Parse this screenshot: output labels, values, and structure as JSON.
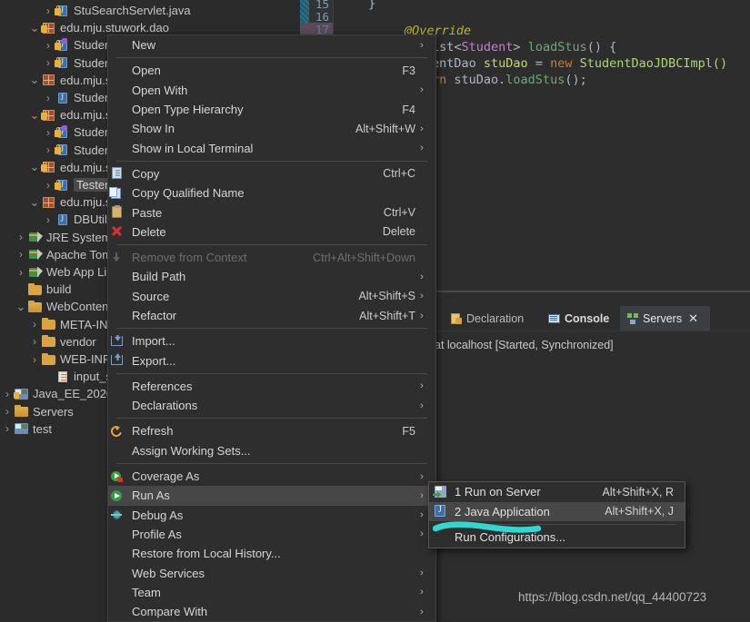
{
  "editor": {
    "line_numbers": [
      "15",
      "16",
      "17"
    ],
    "lines": [
      {
        "segments": [
          {
            "t": "}",
            "c": "c-plain"
          }
        ]
      },
      {
        "segments": []
      },
      {
        "segments": [
          {
            "t": "@Override",
            "c": "c-ann"
          }
        ]
      },
      {
        "segments": [
          {
            "t": "ist<",
            "c": "c-plain"
          },
          {
            "t": "Student",
            "c": "c-type"
          },
          {
            "t": "> ",
            "c": "c-plain"
          },
          {
            "t": "loadStus",
            "c": "c-meth"
          },
          {
            "t": "() {",
            "c": "c-plain"
          }
        ]
      },
      {
        "segments": [
          {
            "t": "entDao ",
            "c": "c-plain"
          },
          {
            "t": "stuDao",
            "c": "c-ident"
          },
          {
            "t": " = ",
            "c": "c-plain"
          },
          {
            "t": "new ",
            "c": "c-kw"
          },
          {
            "t": "StudentDaoJDBCImpl()",
            "c": "c-cls"
          }
        ]
      },
      {
        "segments": [
          {
            "t": "rn ",
            "c": "c-kw"
          },
          {
            "t": "stuDao.",
            "c": "c-plain"
          },
          {
            "t": "loadStus",
            "c": "c-meth"
          },
          {
            "t": "();",
            "c": "c-plain"
          }
        ]
      }
    ]
  },
  "panel": {
    "tabs": [
      {
        "label": "Declaration",
        "icon": "declaration-icon",
        "active": false,
        "bold": false,
        "closable": false
      },
      {
        "label": "Console",
        "icon": "console-icon",
        "active": false,
        "bold": true,
        "closable": false
      },
      {
        "label": "Servers",
        "icon": "servers-icon",
        "active": true,
        "bold": false,
        "closable": true
      }
    ],
    "close_glyph": "✕",
    "server_row": "at localhost  [Started, Synchronized]"
  },
  "tree": {
    "items": [
      {
        "label": "StuSearchServlet.java",
        "indent": 3,
        "twisty": "collapsed",
        "icon": "java-file-locked",
        "selected": false
      },
      {
        "label": "edu.mju.stuwork.dao",
        "indent": 2,
        "twisty": "expanded",
        "icon": "package-locked",
        "selected": false
      },
      {
        "label": "Studen",
        "indent": 3,
        "twisty": "collapsed",
        "icon": "java-interface-locked",
        "selected": false
      },
      {
        "label": "Studen",
        "indent": 3,
        "twisty": "collapsed",
        "icon": "java-file-locked",
        "selected": false
      },
      {
        "label": "edu.mju.s",
        "indent": 2,
        "twisty": "expanded",
        "icon": "package",
        "selected": false
      },
      {
        "label": "Studen",
        "indent": 3,
        "twisty": "collapsed",
        "icon": "java-file",
        "selected": false
      },
      {
        "label": "edu.mju.s",
        "indent": 2,
        "twisty": "expanded",
        "icon": "package-locked",
        "selected": false
      },
      {
        "label": "Studen",
        "indent": 3,
        "twisty": "collapsed",
        "icon": "java-interface-locked",
        "selected": false
      },
      {
        "label": "Studen",
        "indent": 3,
        "twisty": "collapsed",
        "icon": "java-file-locked",
        "selected": false
      },
      {
        "label": "edu.mju.s",
        "indent": 2,
        "twisty": "expanded",
        "icon": "package-locked",
        "selected": false
      },
      {
        "label": "Tester.",
        "indent": 3,
        "twisty": "collapsed",
        "icon": "java-file-locked",
        "selected": true
      },
      {
        "label": "edu.mju.s",
        "indent": 2,
        "twisty": "expanded",
        "icon": "package",
        "selected": false
      },
      {
        "label": "DBUtils",
        "indent": 3,
        "twisty": "collapsed",
        "icon": "java-file",
        "selected": false
      },
      {
        "label": "JRE System ",
        "indent": 1,
        "twisty": "collapsed",
        "icon": "library",
        "selected": false
      },
      {
        "label": "Apache Tom",
        "indent": 1,
        "twisty": "collapsed",
        "icon": "library",
        "selected": false
      },
      {
        "label": "Web App Lil",
        "indent": 1,
        "twisty": "collapsed",
        "icon": "library",
        "selected": false
      },
      {
        "label": "build",
        "indent": 1,
        "twisty": "none",
        "icon": "folder",
        "selected": false
      },
      {
        "label": "WebContent",
        "indent": 1,
        "twisty": "expanded",
        "icon": "folder-open",
        "selected": false
      },
      {
        "label": "META-INI",
        "indent": 2,
        "twisty": "collapsed",
        "icon": "folder",
        "selected": false
      },
      {
        "label": "vendor",
        "indent": 2,
        "twisty": "collapsed",
        "icon": "folder",
        "selected": false
      },
      {
        "label": "WEB-INF",
        "indent": 2,
        "twisty": "collapsed",
        "icon": "folder",
        "selected": false
      },
      {
        "label": "input_stud",
        "indent": 3,
        "twisty": "none",
        "icon": "html-file",
        "selected": false
      },
      {
        "label": "Java_EE_2020-1",
        "indent": 0,
        "twisty": "collapsed",
        "icon": "project-locked",
        "selected": false
      },
      {
        "label": "Servers",
        "indent": 0,
        "twisty": "collapsed",
        "icon": "folder-project",
        "selected": false
      },
      {
        "label": "test",
        "indent": 0,
        "twisty": "collapsed",
        "icon": "project",
        "selected": false
      }
    ]
  },
  "context_menu": {
    "arrow_glyph": "›",
    "items": [
      {
        "label": "New",
        "accel": "",
        "icon": "",
        "arrow": true,
        "sep_after": true,
        "disabled": false,
        "highlight": false
      },
      {
        "label": "Open",
        "accel": "F3",
        "icon": "",
        "arrow": false,
        "sep_after": false,
        "disabled": false,
        "highlight": false
      },
      {
        "label": "Open With",
        "accel": "",
        "icon": "",
        "arrow": true,
        "sep_after": false,
        "disabled": false,
        "highlight": false
      },
      {
        "label": "Open Type Hierarchy",
        "accel": "F4",
        "icon": "",
        "arrow": false,
        "sep_after": false,
        "disabled": false,
        "highlight": false
      },
      {
        "label": "Show In",
        "accel": "Alt+Shift+W",
        "icon": "",
        "arrow": true,
        "sep_after": false,
        "disabled": false,
        "highlight": false
      },
      {
        "label": "Show in Local Terminal",
        "accel": "",
        "icon": "",
        "arrow": true,
        "sep_after": true,
        "disabled": false,
        "highlight": false
      },
      {
        "label": "Copy",
        "accel": "Ctrl+C",
        "icon": "copy-icon",
        "arrow": false,
        "sep_after": false,
        "disabled": false,
        "highlight": false
      },
      {
        "label": "Copy Qualified Name",
        "accel": "",
        "icon": "copy-qualified-icon",
        "arrow": false,
        "sep_after": false,
        "disabled": false,
        "highlight": false
      },
      {
        "label": "Paste",
        "accel": "Ctrl+V",
        "icon": "paste-icon",
        "arrow": false,
        "sep_after": false,
        "disabled": false,
        "highlight": false
      },
      {
        "label": "Delete",
        "accel": "Delete",
        "icon": "delete-icon",
        "arrow": false,
        "sep_after": true,
        "disabled": false,
        "highlight": false
      },
      {
        "label": "Remove from Context",
        "accel": "Ctrl+Alt+Shift+Down",
        "icon": "remove-from-context-icon",
        "arrow": false,
        "sep_after": false,
        "disabled": true,
        "highlight": false
      },
      {
        "label": "Build Path",
        "accel": "",
        "icon": "",
        "arrow": true,
        "sep_after": false,
        "disabled": false,
        "highlight": false
      },
      {
        "label": "Source",
        "accel": "Alt+Shift+S",
        "icon": "",
        "arrow": true,
        "sep_after": false,
        "disabled": false,
        "highlight": false
      },
      {
        "label": "Refactor",
        "accel": "Alt+Shift+T",
        "icon": "",
        "arrow": true,
        "sep_after": true,
        "disabled": false,
        "highlight": false
      },
      {
        "label": "Import...",
        "accel": "",
        "icon": "import-icon",
        "arrow": false,
        "sep_after": false,
        "disabled": false,
        "highlight": false
      },
      {
        "label": "Export...",
        "accel": "",
        "icon": "export-icon",
        "arrow": false,
        "sep_after": true,
        "disabled": false,
        "highlight": false
      },
      {
        "label": "References",
        "accel": "",
        "icon": "",
        "arrow": true,
        "sep_after": false,
        "disabled": false,
        "highlight": false
      },
      {
        "label": "Declarations",
        "accel": "",
        "icon": "",
        "arrow": true,
        "sep_after": true,
        "disabled": false,
        "highlight": false
      },
      {
        "label": "Refresh",
        "accel": "F5",
        "icon": "refresh-icon",
        "arrow": false,
        "sep_after": false,
        "disabled": false,
        "highlight": false
      },
      {
        "label": "Assign Working Sets...",
        "accel": "",
        "icon": "",
        "arrow": false,
        "sep_after": true,
        "disabled": false,
        "highlight": false
      },
      {
        "label": "Coverage As",
        "accel": "",
        "icon": "coverage-icon",
        "arrow": true,
        "sep_after": false,
        "disabled": false,
        "highlight": false
      },
      {
        "label": "Run As",
        "accel": "",
        "icon": "run-icon",
        "arrow": true,
        "sep_after": false,
        "disabled": false,
        "highlight": true
      },
      {
        "label": "Debug As",
        "accel": "",
        "icon": "debug-icon",
        "arrow": true,
        "sep_after": false,
        "disabled": false,
        "highlight": false
      },
      {
        "label": "Profile As",
        "accel": "",
        "icon": "",
        "arrow": true,
        "sep_after": false,
        "disabled": false,
        "highlight": false
      },
      {
        "label": "Restore from Local History...",
        "accel": "",
        "icon": "",
        "arrow": false,
        "sep_after": false,
        "disabled": false,
        "highlight": false
      },
      {
        "label": "Web Services",
        "accel": "",
        "icon": "",
        "arrow": true,
        "sep_after": false,
        "disabled": false,
        "highlight": false
      },
      {
        "label": "Team",
        "accel": "",
        "icon": "",
        "arrow": true,
        "sep_after": false,
        "disabled": false,
        "highlight": false
      },
      {
        "label": "Compare With",
        "accel": "",
        "icon": "",
        "arrow": true,
        "sep_after": false,
        "disabled": false,
        "highlight": false
      }
    ]
  },
  "submenu": {
    "items": [
      {
        "label": "1 Run on Server",
        "accel": "Alt+Shift+X, R",
        "icon": "run-on-server-icon",
        "highlight": false,
        "sep_after": false
      },
      {
        "label": "2 Java Application",
        "accel": "Alt+Shift+X, J",
        "icon": "java-application-icon",
        "highlight": true,
        "sep_after": true
      },
      {
        "label": "Run Configurations...",
        "accel": "",
        "icon": "",
        "highlight": false,
        "sep_after": false
      }
    ]
  },
  "annotation": {
    "color": "#2fd8d0"
  },
  "watermark": {
    "text": "https://blog.csdn.net/qq_44400723"
  }
}
